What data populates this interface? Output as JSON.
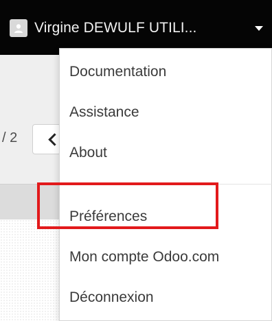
{
  "topbar": {
    "user_name": "Virgine DEWULF UTILI...",
    "avatar_icon": "user-avatar-icon",
    "caret_icon": "caret-down-icon"
  },
  "background": {
    "pager_value": "/ 2",
    "prev_icon": "chevron-left-icon"
  },
  "dropdown": {
    "items": [
      {
        "label": "Documentation"
      },
      {
        "label": "Assistance"
      },
      {
        "label": "About"
      },
      {
        "label": "Préférences"
      },
      {
        "label": "Mon compte Odoo.com"
      },
      {
        "label": "Déconnexion"
      }
    ],
    "highlight_color": "#e2191b"
  }
}
